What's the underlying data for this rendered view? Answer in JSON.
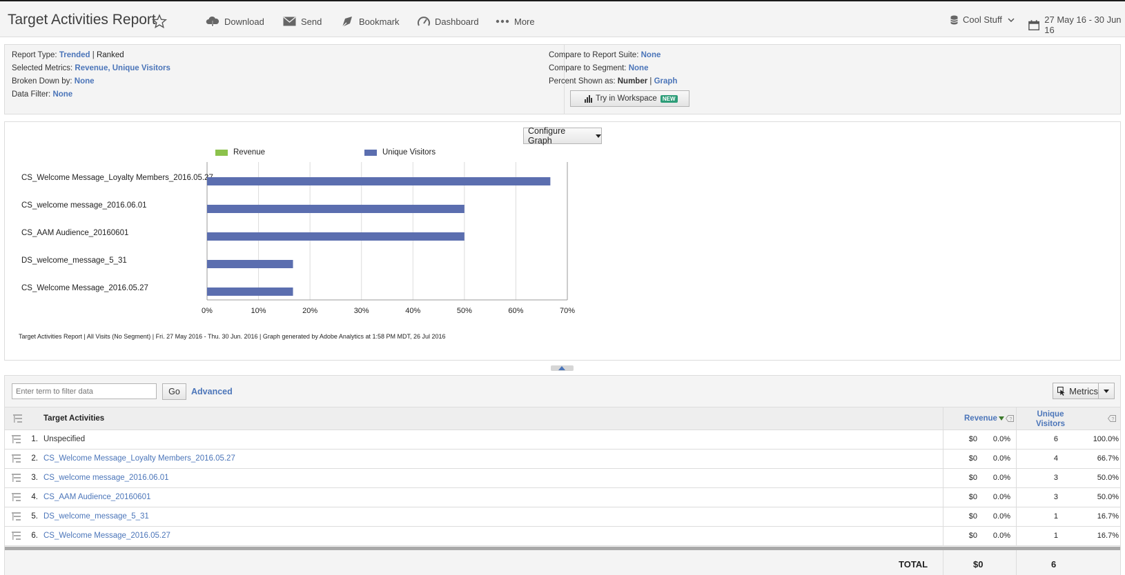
{
  "header": {
    "title": "Target Activities Report",
    "tools": {
      "download": "Download",
      "send": "Send",
      "bookmark": "Bookmark",
      "dashboard": "Dashboard",
      "more": "More"
    },
    "report_suite": "Cool Stuff",
    "date_range": "27 May 16 - 30 Jun 16"
  },
  "info": {
    "report_type_label": "Report Type:",
    "report_type_trended": "Trended",
    "report_type_sep": "|",
    "report_type_ranked": "Ranked",
    "metrics_label": "Selected Metrics:",
    "metrics_value": "Revenue, Unique Visitors",
    "breakdown_label": "Broken Down by:",
    "breakdown_value": "None",
    "filter_label": "Data Filter:",
    "filter_value": "None",
    "compare_suite_label": "Compare to Report Suite:",
    "compare_suite_value": "None",
    "compare_segment_label": "Compare to Segment:",
    "compare_segment_value": "None",
    "percent_label": "Percent Shown as:",
    "percent_number": "Number",
    "percent_sep": "|",
    "percent_graph": "Graph",
    "try_workspace": "Try in Workspace",
    "new_badge": "NEW"
  },
  "graph": {
    "configure_label": "Configure Graph",
    "footnote": "Target Activities Report | All Visits (No Segment) | Fri. 27 May 2016 - Thu. 30 Jun. 2016 | Graph generated by Adobe Analytics at  1:58 PM MDT, 26 Jul 2016"
  },
  "chart_data": {
    "type": "bar",
    "orientation": "horizontal",
    "categories": [
      "CS_Welcome Message_Loyalty Members_2016.05.27",
      "CS_welcome message_2016.06.01",
      "CS_AAM Audience_20160601",
      "DS_welcome_message_5_31",
      "CS_Welcome Message_2016.05.27"
    ],
    "series": [
      {
        "name": "Revenue",
        "color": "#8cc24c",
        "values": [
          0,
          0,
          0,
          0,
          0
        ]
      },
      {
        "name": "Unique Visitors",
        "color": "#5b6eaf",
        "values": [
          66.7,
          50.0,
          50.0,
          16.7,
          16.7
        ]
      }
    ],
    "xlim": [
      0,
      70
    ],
    "xticks": [
      "0%",
      "10%",
      "20%",
      "30%",
      "40%",
      "50%",
      "60%",
      "70%"
    ],
    "grid": true,
    "legend": "top"
  },
  "table": {
    "filter_placeholder": "Enter term to filter data",
    "go_label": "Go",
    "advanced_label": "Advanced",
    "metrics_label": "Metrics",
    "col_title": "Target Activities",
    "col_revenue": "Revenue",
    "col_unique_visitors": "Unique Visitors",
    "rows": [
      {
        "rank": "1.",
        "name": "Unspecified",
        "rev": "$0",
        "rev_pct": "0.0%",
        "uv": "6",
        "uv_pct": "100.0%"
      },
      {
        "rank": "2.",
        "name": "CS_Welcome Message_Loyalty Members_2016.05.27",
        "rev": "$0",
        "rev_pct": "0.0%",
        "uv": "4",
        "uv_pct": "66.7%"
      },
      {
        "rank": "3.",
        "name": "CS_welcome message_2016.06.01",
        "rev": "$0",
        "rev_pct": "0.0%",
        "uv": "3",
        "uv_pct": "50.0%"
      },
      {
        "rank": "4.",
        "name": "CS_AAM Audience_20160601",
        "rev": "$0",
        "rev_pct": "0.0%",
        "uv": "3",
        "uv_pct": "50.0%"
      },
      {
        "rank": "5.",
        "name": "DS_welcome_message_5_31",
        "rev": "$0",
        "rev_pct": "0.0%",
        "uv": "1",
        "uv_pct": "16.7%"
      },
      {
        "rank": "6.",
        "name": "CS_Welcome Message_2016.05.27",
        "rev": "$0",
        "rev_pct": "0.0%",
        "uv": "1",
        "uv_pct": "16.7%"
      }
    ],
    "total_label": "TOTAL",
    "total_revenue": "$0",
    "total_unique_visitors": "6"
  },
  "colors": {
    "link": "#4b75b9",
    "bar": "#5b6eaf",
    "revenue_legend": "#8cc24c"
  }
}
